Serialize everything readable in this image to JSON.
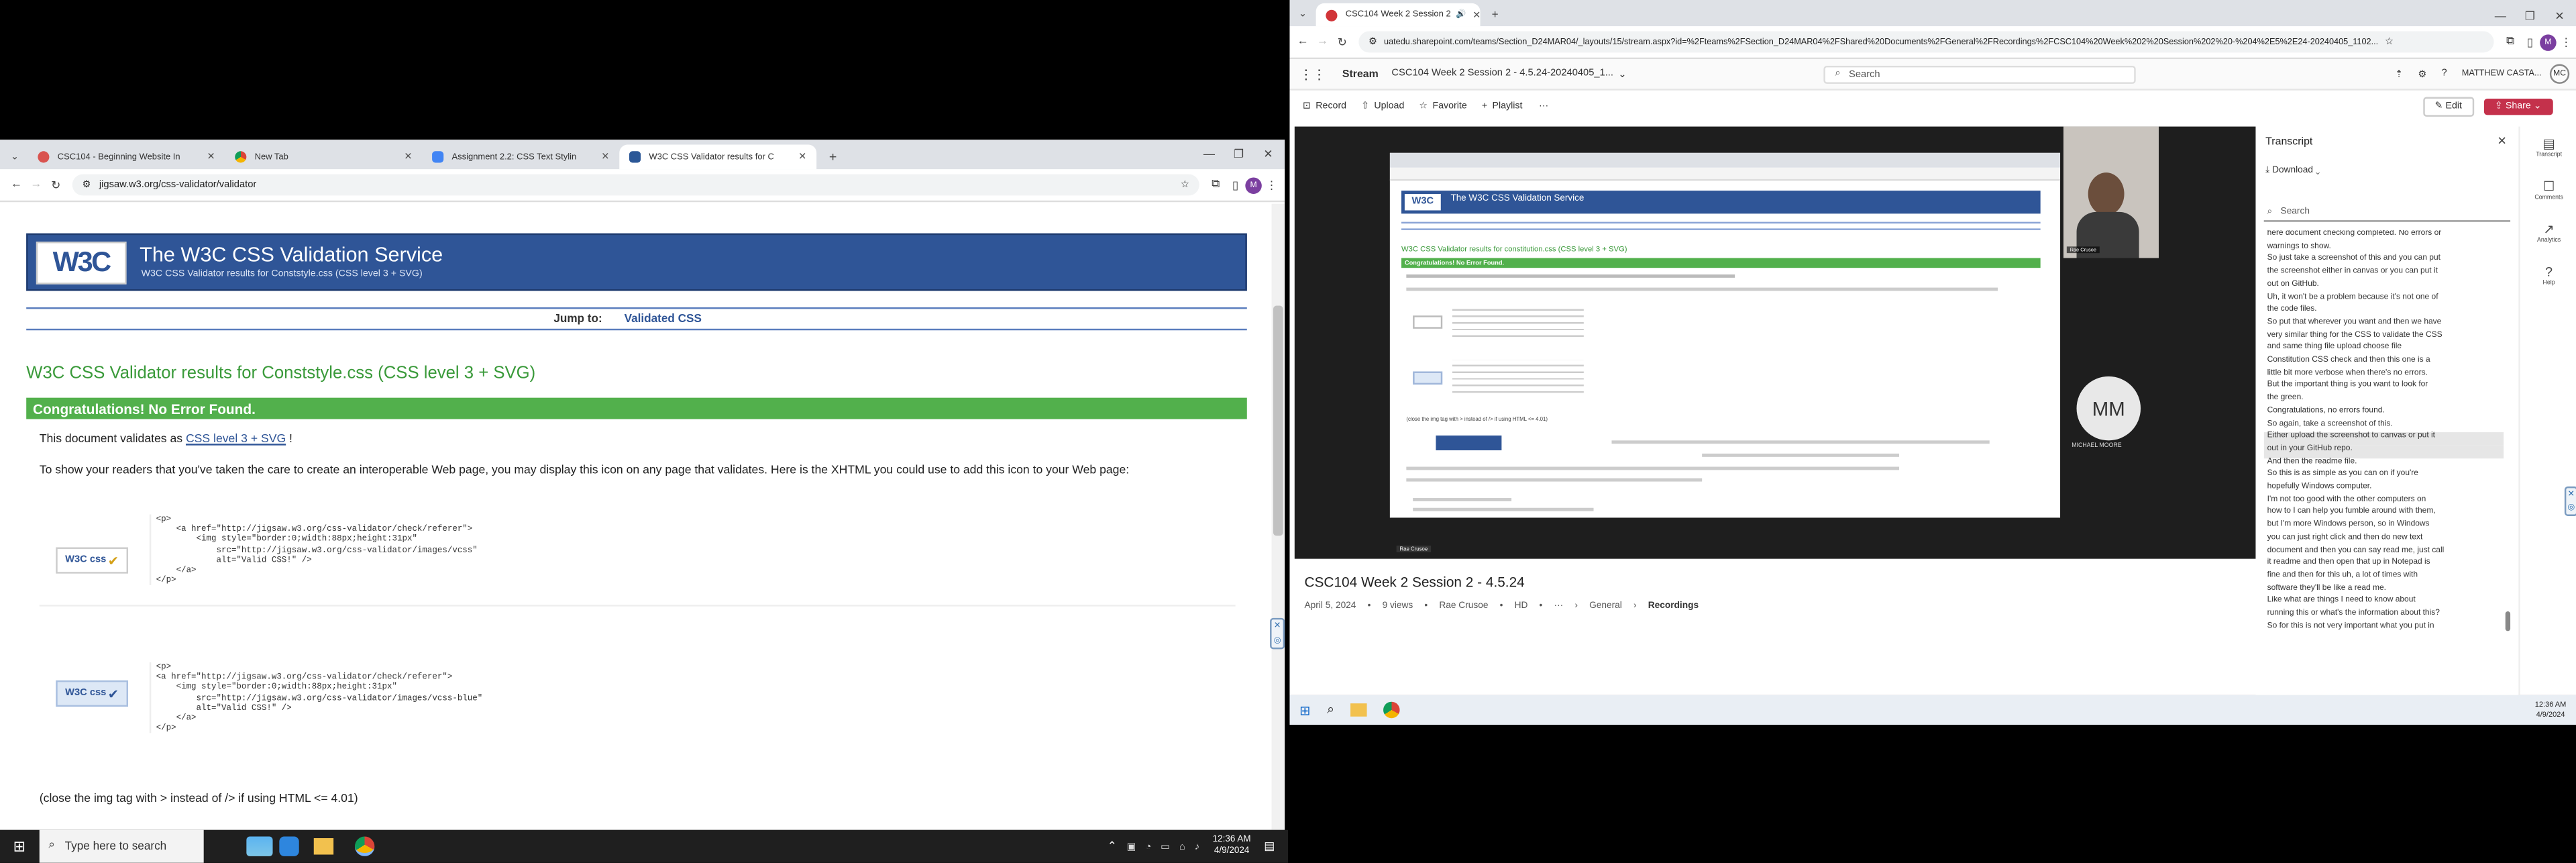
{
  "left": {
    "tabs": [
      {
        "label": "CSC104 - Beginning Website In",
        "icon": "cengage-icon"
      },
      {
        "label": "New Tab",
        "icon": "chrome-icon"
      },
      {
        "label": "Assignment 2.2: CSS Text Stylin",
        "icon": "docs-icon"
      },
      {
        "label": "W3C CSS Validator results for C",
        "icon": "w3c-icon"
      }
    ],
    "url": "jigsaw.w3.org/css-validator/validator",
    "page": {
      "header_title": "The W3C CSS Validation Service",
      "header_subtitle": "W3C CSS Validator results for Conststyle.css (CSS level 3 + SVG)",
      "logo": "W3C",
      "jump_label": "Jump to:",
      "jump_link": "Validated CSS",
      "results_title": "W3C CSS Validator results for Conststyle.css (CSS level 3 + SVG)",
      "congrats": "Congratulations! No Error Found.",
      "validates_prefix": "This document validates as ",
      "validates_link": "CSS level 3 + SVG",
      "validates_suffix": " !",
      "interop": "To show your readers that you've taken the care to create an interoperable Web page, you may display this icon on any page that validates. Here is the XHTML you could use to add this icon to your Web page:",
      "code1": "<p>\n    <a href=\"http://jigsaw.w3.org/css-validator/check/referer\">\n        <img style=\"border:0;width:88px;height:31px\"\n            src=\"http://jigsaw.w3.org/css-validator/images/vcss\"\n            alt=\"Valid CSS!\" />\n    </a>\n</p>",
      "code2": "<p>\n<a href=\"http://jigsaw.w3.org/css-validator/check/referer\">\n    <img style=\"border:0;width:88px;height:31px\"\n        src=\"http://jigsaw.w3.org/css-validator/images/vcss-blue\"\n        alt=\"Valid CSS!\" />\n    </a>\n</p>",
      "badge_text": "W3C css",
      "close_note": "(close the img tag with > instead of /> if using HTML <= 4.01)"
    },
    "taskbar": {
      "search_placeholder": "Type here to search",
      "time": "12:36 AM",
      "date": "4/9/2024"
    }
  },
  "right": {
    "tab_title": "CSC104 Week 2 Session 2",
    "url": "uatedu.sharepoint.com/teams/Section_D24MAR04/_layouts/15/stream.aspx?id=%2Fteams%2FSection_D24MAR04%2FShared%20Documents%2FGeneral%2FRecordings%2FCSC104%20Week%202%20Session%202%20-%204%2E5%2E24-20240405_1102...",
    "app_name": "Stream",
    "file_title": "CSC104 Week 2 Session 2 - 4.5.24-20240405_1...",
    "search_placeholder": "Search",
    "user_name": "MATTHEW CASTA...",
    "user_initials": "MC",
    "toolbar": {
      "record": "Record",
      "upload": "Upload",
      "favorite": "Favorite",
      "playlist": "Playlist",
      "edit": "Edit",
      "share": "Share"
    },
    "video": {
      "title": "CSC104 Week 2 Session 2 - 4.5.24",
      "date": "April 5, 2024",
      "views": "9 views",
      "author": "Rae Crusoe",
      "quality": "HD",
      "crumb1": "General",
      "crumb2": "Recordings",
      "participant_initials": "MM",
      "participant_name": "MICHAEL MOORE",
      "presenter_label": "Rae Crusoe",
      "inner_title": "The W3C CSS Validation Service",
      "inner_results": "W3C CSS Validator results for constitution.css (CSS level 3 + SVG)",
      "inner_congrats": "Congratulations! No Error Found.",
      "inner_close": "(close the img tag with > instead of /> if using HTML <= 4.01)",
      "inner_developers": "DEVELOPERS"
    },
    "transcript": {
      "title": "Transcript",
      "download": "Download",
      "search_placeholder": "Search",
      "lines": [
        "here document checking completed. No errors or",
        "warnings to show.",
        "So just take a screenshot of this and you can put",
        "the screenshot either in canvas or you can put it",
        "out on GitHub.",
        "Uh, it won't be a problem because it's not one of",
        "the code files.",
        "So put that wherever you want and then we have",
        "very similar thing for the CSS to validate the CSS",
        "and same thing file upload choose file",
        "Constitution CSS check and then this one is a",
        "little bit more verbose when there's no errors.",
        "But the important thing is you want to look for",
        "the green.",
        "Congratulations, no errors found.",
        "So again, take a screenshot of this.",
        "Either upload the screenshot to canvas or put it",
        "out in your GitHub repo.",
        "And then the readme file.",
        "So this is as simple as you can on if you're",
        "hopefully Windows computer.",
        "I'm not too good with the other computers on",
        "how to I can help you fumble around with them,",
        "but I'm more Windows person, so in Windows",
        "you can just right click and then do new text",
        "document and then you can say read me, just call",
        "it readme and then open that up in Notepad is",
        "fine and then for this uh, a lot of times with",
        "software they'll be like a read me.",
        "Like what are things I need to know about",
        "running this or what's the information about this?",
        "So for this is not very important what you put in"
      ],
      "highlight_start": 16,
      "highlight_end": 17
    },
    "side_rail": {
      "transcript": "Transcript",
      "comments": "Comments",
      "analytics": "Analytics",
      "help": "Help"
    },
    "taskbar": {
      "time": "12:36 AM",
      "date": "4/9/2024"
    }
  }
}
